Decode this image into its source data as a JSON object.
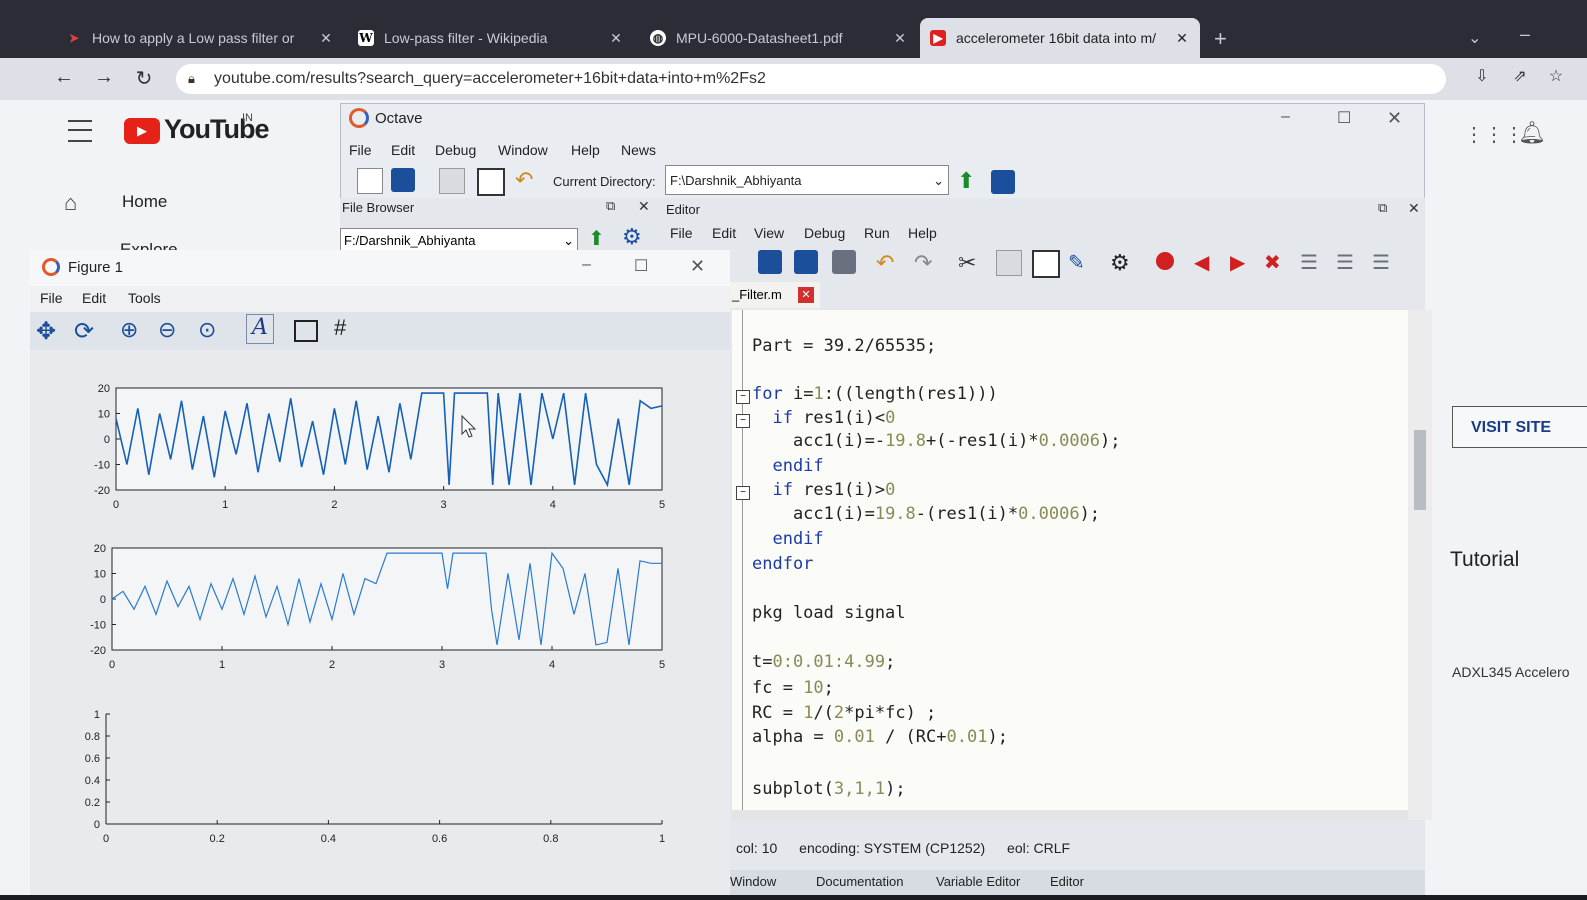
{
  "browser": {
    "tabs": [
      {
        "label": "How to apply a Low pass filter or",
        "icon": "arrow-logo-icon"
      },
      {
        "label": "Low-pass filter - Wikipedia",
        "icon": "wikipedia-icon"
      },
      {
        "label": "MPU-6000-Datasheet1.pdf",
        "icon": "globe-icon"
      },
      {
        "label": "accelerometer 16bit data into m/",
        "icon": "youtube-icon"
      }
    ],
    "url": "youtube.com/results?search_query=accelerometer+16bit+data+into+m%2Fs2"
  },
  "youtube": {
    "logo": "YouTube",
    "region": "IN",
    "nav_home": "Home",
    "nav_explore": "Explore",
    "visit_site": "VISIT SITE",
    "tutorial": "Tutorial",
    "adxl": "ADXL345 Accelero"
  },
  "octave": {
    "title": "Octave",
    "menus": [
      "File",
      "Edit",
      "Debug",
      "Window",
      "Help",
      "News"
    ],
    "current_directory_label": "Current Directory:",
    "current_directory": "F:\\Darshnik_Abhiyanta",
    "file_browser": {
      "title": "File Browser",
      "path": "F:/Darshnik_Abhiyanta"
    },
    "editor": {
      "title": "Editor",
      "menus": [
        "File",
        "Edit",
        "View",
        "Debug",
        "Run",
        "Help"
      ],
      "tab": "_Filter.m",
      "status": {
        "col_label": "col:",
        "col": "10",
        "encoding_label": "encoding:",
        "encoding": "SYSTEM (CP1252)",
        "eol_label": "eol:",
        "eol": "CRLF"
      },
      "bottom_tabs": [
        "Window",
        "Documentation",
        "Variable Editor",
        "Editor"
      ]
    }
  },
  "code": {
    "l1": "Part = 39.2/65535;",
    "l2a": "for",
    "l2b": " i=",
    "l2c": "1",
    "l2d": ":((length(res1)))",
    "l3a": "  if",
    "l3b": " res1(i)<",
    "l3c": "0",
    "l4a": "    acc1(i)=-",
    "l4b": "19.8",
    "l4c": "+(-res1(i)*",
    "l4d": "0.0006",
    "l4e": ");",
    "l5": "  endif",
    "l6a": "  if",
    "l6b": " res1(i)>",
    "l6c": "0",
    "l7a": "    acc1(i)=",
    "l7b": "19.8",
    "l7c": "-(res1(i)*",
    "l7d": "0.0006",
    "l7e": ");",
    "l8": "  endif",
    "l9": "endfor",
    "l10": "pkg load signal",
    "l11a": "t=",
    "l11b": "0:0.01:4.99",
    "l11c": ";",
    "l12a": "fc = ",
    "l12b": "10",
    "l12c": ";",
    "l13a": "RC = ",
    "l13b": "1",
    "l13c": "/(",
    "l13d": "2",
    "l13e": "*pi*fc) ;",
    "l14a": "alpha = ",
    "l14b": "0.01",
    "l14c": " / (RC+",
    "l14d": "0.01",
    "l14e": ");",
    "l15a": "subplot(",
    "l15b": "3,1,1",
    "l15c": ");"
  },
  "figure": {
    "title": "Figure 1",
    "menus": [
      "File",
      "Edit",
      "Tools"
    ]
  },
  "chart_data": [
    {
      "type": "line",
      "title": "",
      "xlim": [
        0,
        5
      ],
      "ylim": [
        -20,
        20
      ],
      "xticks": [
        "0",
        "1",
        "2",
        "3",
        "4",
        "5"
      ],
      "yticks": [
        "20",
        "10",
        "0",
        "-10",
        "-20"
      ],
      "x": [
        0,
        0.1,
        0.2,
        0.3,
        0.4,
        0.5,
        0.6,
        0.7,
        0.8,
        0.9,
        1.0,
        1.1,
        1.2,
        1.3,
        1.4,
        1.5,
        1.6,
        1.7,
        1.8,
        1.9,
        2.0,
        2.1,
        2.2,
        2.3,
        2.4,
        2.5,
        2.6,
        2.7,
        2.8,
        2.9,
        3.0,
        3.05,
        3.1,
        3.3,
        3.4,
        3.45,
        3.5,
        3.6,
        3.7,
        3.8,
        3.9,
        4.0,
        4.1,
        4.2,
        4.3,
        4.4,
        4.5,
        4.6,
        4.7,
        4.8,
        4.9,
        5.0
      ],
      "y": [
        8,
        -10,
        12,
        -14,
        10,
        -8,
        15,
        -12,
        9,
        -15,
        11,
        -6,
        14,
        -13,
        10,
        -9,
        16,
        -11,
        7,
        -14,
        12,
        -10,
        15,
        -12,
        9,
        -13,
        14,
        -8,
        18,
        18,
        18,
        -18,
        18,
        18,
        18,
        -18,
        18,
        -18,
        18,
        -18,
        18,
        0,
        18,
        -18,
        18,
        -10,
        -18,
        8,
        -18,
        15,
        12,
        13
      ]
    },
    {
      "type": "line",
      "title": "",
      "xlim": [
        0,
        5
      ],
      "ylim": [
        -20,
        20
      ],
      "xticks": [
        "0",
        "1",
        "2",
        "3",
        "4",
        "5"
      ],
      "yticks": [
        "20",
        "10",
        "0",
        "-10",
        "-20"
      ],
      "x": [
        0,
        0.1,
        0.2,
        0.3,
        0.4,
        0.5,
        0.6,
        0.7,
        0.8,
        0.9,
        1.0,
        1.1,
        1.2,
        1.3,
        1.4,
        1.5,
        1.6,
        1.7,
        1.8,
        1.9,
        2.0,
        2.1,
        2.2,
        2.3,
        2.4,
        2.5,
        2.6,
        2.7,
        2.8,
        2.9,
        3.0,
        3.05,
        3.1,
        3.3,
        3.4,
        3.45,
        3.5,
        3.6,
        3.7,
        3.8,
        3.9,
        4.0,
        4.1,
        4.2,
        4.3,
        4.4,
        4.5,
        4.6,
        4.7,
        4.8,
        4.9,
        5.0
      ],
      "y": [
        0,
        3,
        -4,
        5,
        -6,
        7,
        -3,
        5,
        -8,
        6,
        -4,
        8,
        -6,
        9,
        -7,
        5,
        -10,
        8,
        -9,
        6,
        -8,
        10,
        -6,
        8,
        6,
        18,
        18,
        18,
        18,
        18,
        18,
        4,
        18,
        18,
        18,
        -4,
        -18,
        10,
        -16,
        14,
        -18,
        18,
        12,
        -6,
        10,
        -18,
        -17,
        12,
        -18,
        15,
        14,
        14
      ]
    },
    {
      "type": "line",
      "title": "",
      "xlim": [
        0,
        1
      ],
      "ylim": [
        0,
        1
      ],
      "xticks": [
        "0",
        "0.2",
        "0.4",
        "0.6",
        "0.8",
        "1"
      ],
      "yticks": [
        "1",
        "0.8",
        "0.6",
        "0.4",
        "0.2",
        "0"
      ],
      "x": [],
      "y": []
    }
  ]
}
